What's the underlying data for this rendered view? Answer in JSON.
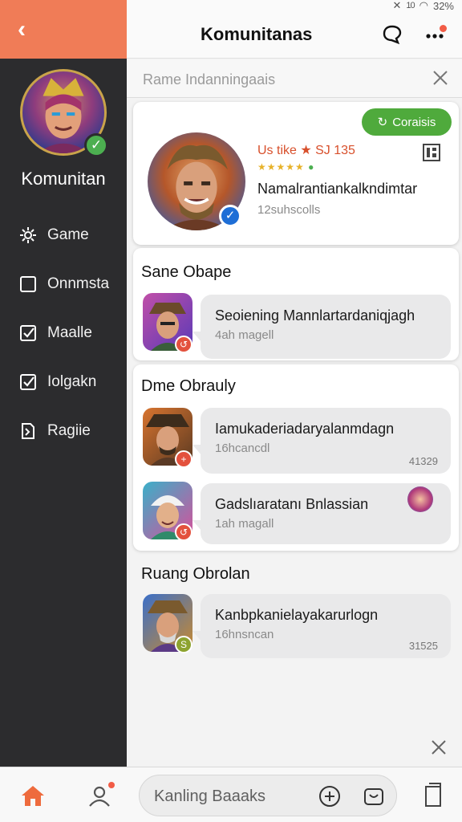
{
  "status_bar": {
    "signal_text": "10",
    "battery": "32%"
  },
  "sidebar": {
    "title": "Komunitan",
    "items": [
      {
        "label": "Game",
        "icon": "gear-icon"
      },
      {
        "label": "Onnmsta",
        "icon": "square-icon"
      },
      {
        "label": "Maalle",
        "icon": "checkbox-icon"
      },
      {
        "label": "Iolgakn",
        "icon": "checkbox-icon"
      },
      {
        "label": "Ragiie",
        "icon": "bookmark-icon"
      }
    ]
  },
  "header": {
    "title": "Komunitanas"
  },
  "search": {
    "placeholder": "Rame Indanningaais"
  },
  "featured": {
    "button_label": "Coraisis",
    "tag": "Us tike ★ SJ 135",
    "stars": "★★★★★",
    "name": "Namalrantiankalkndimtar",
    "subtitle": "12suhscolls"
  },
  "sections": [
    {
      "title": "Sane Obape",
      "items": [
        {
          "title": "Seoiening Mannlartardaniqjagh",
          "subtitle": "4ah magell",
          "count": ""
        }
      ]
    },
    {
      "title": "Dme Obrauly",
      "items": [
        {
          "title": "Iamukaderiadaryalanmdagn",
          "subtitle": "16hcancdl",
          "count": "41329"
        },
        {
          "title": "Gadslıaratanı Bnlassian",
          "subtitle": "1ah magall",
          "count": ""
        }
      ]
    },
    {
      "title": "Ruang Obrolan",
      "items": [
        {
          "title": "Kanbpkanielayakarurlogn",
          "subtitle": "16hnsncan",
          "count": "31525"
        }
      ]
    }
  ],
  "composer": {
    "placeholder": "Kanling Baaaks"
  },
  "colors": {
    "accent": "#f07c57",
    "sidebar": "#2c2c2e",
    "button_green": "#4faa3c",
    "badge_red": "#e3513d",
    "verify_blue": "#1e6ed6"
  }
}
